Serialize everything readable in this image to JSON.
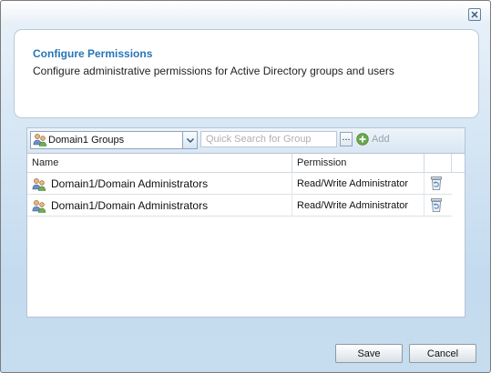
{
  "dialog": {
    "close_icon": "close-icon"
  },
  "header": {
    "title": "Configure Permissions",
    "description": "Configure administrative permissions for Active Directory groups and users"
  },
  "toolbar": {
    "group_select": {
      "selected": "Domain1 Groups",
      "icon": "group-icon"
    },
    "search": {
      "placeholder": "Quick Search for Group",
      "value": ""
    },
    "browse_label": "...",
    "add_label": "Add",
    "add_icon": "plus-circle-icon"
  },
  "grid": {
    "columns": {
      "name": "Name",
      "permission": "Permission"
    },
    "rows": [
      {
        "name": "Domain1/Domain Administrators",
        "permission": "Read/Write Administrator"
      },
      {
        "name": "Domain1/Domain Administrators",
        "permission": "Read/Write Administrator"
      }
    ]
  },
  "footer": {
    "save_label": "Save",
    "cancel_label": "Cancel"
  },
  "colors": {
    "title_accent": "#2675b8",
    "dialog_background": "#c6dcef",
    "add_icon": "#6aa84f"
  }
}
